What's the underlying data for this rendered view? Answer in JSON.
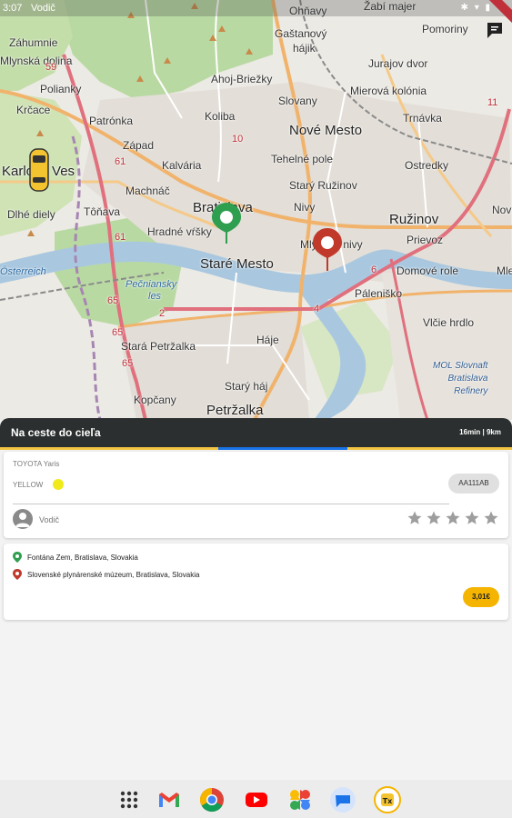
{
  "status_bar": {
    "time": "3:07",
    "app_name": "Vodič"
  },
  "map": {
    "labels": [
      {
        "text": "Ohňavy",
        "cls": "",
        "l": 318,
        "t": 5
      },
      {
        "text": "Žabí majer",
        "cls": "",
        "l": 400,
        "t": 0
      },
      {
        "text": "Gaštanový",
        "cls": "",
        "l": 302,
        "t": 30
      },
      {
        "text": "hájik",
        "cls": "",
        "l": 322,
        "t": 46
      },
      {
        "text": "Pomoriny",
        "cls": "",
        "l": 464,
        "t": 25
      },
      {
        "text": "Jurajov dvor",
        "cls": "",
        "l": 405,
        "t": 63
      },
      {
        "text": "Ahoj-Briežky",
        "cls": "",
        "l": 232,
        "t": 80
      },
      {
        "text": "Slovany",
        "cls": "",
        "l": 306,
        "t": 104
      },
      {
        "text": "Mierová kolónia",
        "cls": "",
        "l": 385,
        "t": 93
      },
      {
        "text": "Trnávka",
        "cls": "",
        "l": 443,
        "t": 123
      },
      {
        "text": "Koliba",
        "cls": "",
        "l": 225,
        "t": 121
      },
      {
        "text": "Nové Mesto",
        "cls": "big",
        "l": 318,
        "t": 135
      },
      {
        "text": "Patrónka",
        "cls": "",
        "l": 98,
        "t": 126
      },
      {
        "text": "Záhumnie",
        "cls": "",
        "l": 10,
        "t": 40
      },
      {
        "text": "Mlynská dolina",
        "cls": "",
        "l": 0,
        "t": 60
      },
      {
        "text": "Polianky",
        "cls": "",
        "l": 44,
        "t": 91
      },
      {
        "text": "Krčace",
        "cls": "",
        "l": 18,
        "t": 114
      },
      {
        "text": "Západ",
        "cls": "",
        "l": 135,
        "t": 153
      },
      {
        "text": "Kalvária",
        "cls": "",
        "l": 178,
        "t": 175
      },
      {
        "text": "Tehelné pole",
        "cls": "",
        "l": 298,
        "t": 168
      },
      {
        "text": "Ostredky",
        "cls": "",
        "l": 445,
        "t": 175
      },
      {
        "text": "Karlova Ves",
        "cls": "big",
        "l": 2,
        "t": 180
      },
      {
        "text": "Machnáč",
        "cls": "",
        "l": 138,
        "t": 203
      },
      {
        "text": "Starý Ružinov",
        "cls": "",
        "l": 318,
        "t": 197
      },
      {
        "text": "Dlhé diely",
        "cls": "",
        "l": 8,
        "t": 229
      },
      {
        "text": "Tôňava",
        "cls": "",
        "l": 92,
        "t": 226
      },
      {
        "text": "Bratislava",
        "cls": "big",
        "l": 212,
        "t": 220
      },
      {
        "text": "Nivy",
        "cls": "",
        "l": 323,
        "t": 221
      },
      {
        "text": "Ružinov",
        "cls": "big",
        "l": 428,
        "t": 233
      },
      {
        "text": "Hradné vŕšky",
        "cls": "",
        "l": 162,
        "t": 248
      },
      {
        "text": "Mlynské nivy",
        "cls": "",
        "l": 330,
        "t": 262
      },
      {
        "text": "Prievoz",
        "cls": "",
        "l": 447,
        "t": 257
      },
      {
        "text": "Staré Mesto",
        "cls": "big",
        "l": 220,
        "t": 282
      },
      {
        "text": "Domové role",
        "cls": "",
        "l": 436,
        "t": 291
      },
      {
        "text": "Petržalka",
        "cls": "big",
        "l": 227,
        "t": 443
      },
      {
        "text": "Páleniško",
        "cls": "",
        "l": 390,
        "t": 316
      },
      {
        "text": "Pečniansky",
        "cls": "water",
        "l": 138,
        "t": 307
      },
      {
        "text": "les",
        "cls": "water",
        "l": 163,
        "t": 320
      },
      {
        "text": "Vlčie hrdlo",
        "cls": "",
        "l": 465,
        "t": 348
      },
      {
        "text": "Stará Petržalka",
        "cls": "",
        "l": 133,
        "t": 374
      },
      {
        "text": "Háje",
        "cls": "",
        "l": 282,
        "t": 367
      },
      {
        "text": "Starý háj",
        "cls": "",
        "l": 247,
        "t": 418
      },
      {
        "text": "Kopčany",
        "cls": "",
        "l": 147,
        "t": 433
      },
      {
        "text": "Österreich",
        "cls": "water",
        "l": 0,
        "t": 293
      },
      {
        "text": "61",
        "cls": "road",
        "l": 126,
        "t": 172
      },
      {
        "text": "61",
        "cls": "road",
        "l": 126,
        "t": 255
      },
      {
        "text": "65",
        "cls": "road",
        "l": 118,
        "t": 325
      },
      {
        "text": "65",
        "cls": "road",
        "l": 123,
        "t": 360
      },
      {
        "text": "65",
        "cls": "road",
        "l": 134,
        "t": 394
      },
      {
        "text": "59",
        "cls": "road",
        "l": 50,
        "t": 68
      },
      {
        "text": "11",
        "cls": "road",
        "l": 536,
        "t": 107
      },
      {
        "text": "6",
        "cls": "road",
        "l": 408,
        "t": 291
      },
      {
        "text": "4",
        "cls": "road",
        "l": 345,
        "t": 334
      },
      {
        "text": "2",
        "cls": "road",
        "l": 175,
        "t": 339
      },
      {
        "text": "10",
        "cls": "road",
        "l": 255,
        "t": 147
      },
      {
        "text": "Nová",
        "cls": "",
        "l": 541,
        "t": 224
      },
      {
        "text": "Mle",
        "cls": "",
        "l": 546,
        "t": 291
      }
    ],
    "poi": {
      "line1": "MOL Slovnaft",
      "line2": "Bratislava",
      "line3": "Refinery"
    }
  },
  "trip": {
    "status_title": "Na ceste do cieľa",
    "eta_distance": "16min | 9km",
    "progress": 0.45
  },
  "vehicle": {
    "model": "TOYOTA Yaris",
    "color_name": "YELLOW",
    "color_hex": "#f1ea1b",
    "plate": "AA111AB"
  },
  "driver": {
    "label": "Vodič",
    "rating_stars": 0,
    "max_stars": 5
  },
  "route": {
    "pickup": "Fontána Zem, Bratislava, Slovakia",
    "destination": "Slovenské plynárenské múzeum, Bratislava, Slovakia",
    "price": "3,01€"
  },
  "colors": {
    "accent_yellow": "#f4b400",
    "header_dark": "#2b2f2f",
    "pickup_green": "#2e9e4f",
    "destination_red": "#c0392b",
    "progress_blue": "#1a73e8"
  },
  "dock": {
    "apps": [
      "app-drawer-icon",
      "gmail-icon",
      "chrome-icon",
      "youtube-icon",
      "photos-icon",
      "messages-icon",
      "taxi-app-icon"
    ]
  }
}
